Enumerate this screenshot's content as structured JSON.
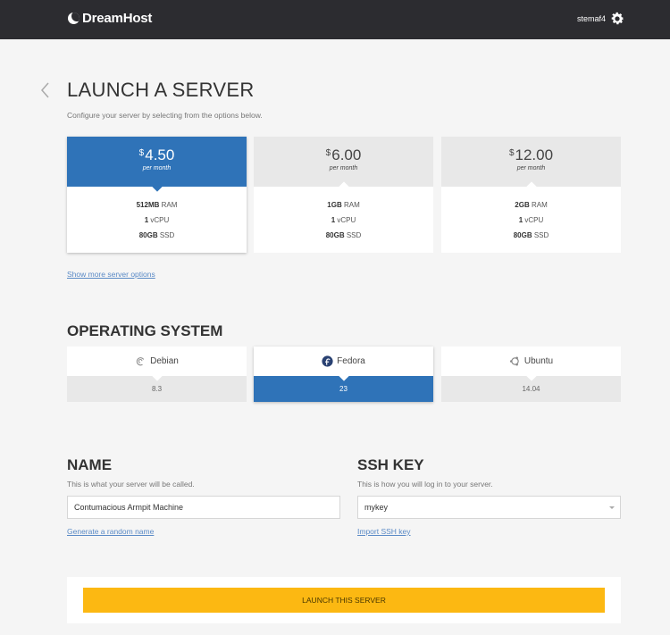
{
  "header": {
    "brand": "DreamHost",
    "username": "stemaf4"
  },
  "page": {
    "title": "LAUNCH A SERVER",
    "subtitle": "Configure your server by selecting from the options below."
  },
  "plans": [
    {
      "currency": "$",
      "price": "4.50",
      "period": "per month",
      "ram_value": "512MB",
      "ram_label": "RAM",
      "cpu_value": "1",
      "cpu_label": "vCPU",
      "ssd_value": "80GB",
      "ssd_label": "SSD",
      "selected": true
    },
    {
      "currency": "$",
      "price": "6.00",
      "period": "per month",
      "ram_value": "1GB",
      "ram_label": "RAM",
      "cpu_value": "1",
      "cpu_label": "vCPU",
      "ssd_value": "80GB",
      "ssd_label": "SSD",
      "selected": false
    },
    {
      "currency": "$",
      "price": "12.00",
      "period": "per month",
      "ram_value": "2GB",
      "ram_label": "RAM",
      "cpu_value": "1",
      "cpu_label": "vCPU",
      "ssd_value": "80GB",
      "ssd_label": "SSD",
      "selected": false
    }
  ],
  "more_options_link": "Show more server options",
  "os_section": {
    "title": "OPERATING SYSTEM",
    "options": [
      {
        "name": "Debian",
        "version": "8.3",
        "icon": "debian-icon",
        "selected": false
      },
      {
        "name": "Fedora",
        "version": "23",
        "icon": "fedora-icon",
        "selected": true
      },
      {
        "name": "Ubuntu",
        "version": "14.04",
        "icon": "ubuntu-icon",
        "selected": false
      }
    ]
  },
  "name_field": {
    "title": "NAME",
    "help": "This is what your server will be called.",
    "value": "Contumacious Armpit Machine",
    "link": "Generate a random name"
  },
  "ssh_field": {
    "title": "SSH KEY",
    "help": "This is how you will log in to your server.",
    "value": "mykey",
    "link": "Import SSH key"
  },
  "launch_button": "LAUNCH THIS SERVER",
  "colors": {
    "topbar": "#2c2c30",
    "selected_blue": "#2f73b8",
    "launch_yellow": "#fcb812",
    "link_blue": "#5a8ac6"
  }
}
